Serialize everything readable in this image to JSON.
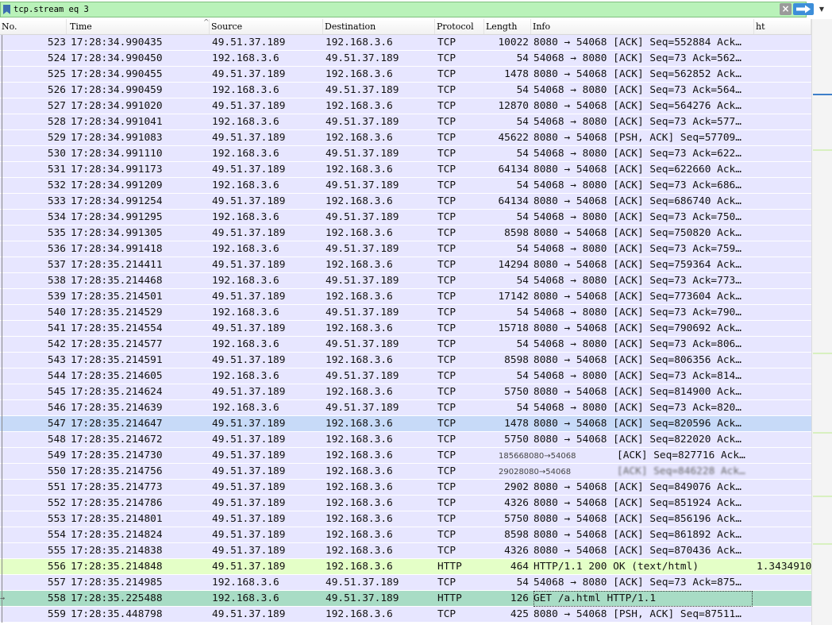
{
  "filter": {
    "value": "tcp.stream eq 3",
    "clear_icon": "close-icon",
    "apply_icon": "arrow-right-icon",
    "dropdown_icon": "chevron-down-icon"
  },
  "columns": {
    "no": "No.",
    "time": "Time",
    "source": "Source",
    "destination": "Destination",
    "protocol": "Protocol",
    "length": "Length",
    "info": "Info",
    "ht": "ht"
  },
  "colors": {
    "tcp_row": "#e7e6ff",
    "http_row": "#e4ffc7",
    "selected_row": "#c7daf8",
    "related_row": "#a8dcc5",
    "filter_bg": "#b9f2b9"
  },
  "packets": [
    {
      "no": "523",
      "time": "17:28:34.990435",
      "src": "49.51.37.189",
      "dst": "192.168.3.6",
      "proto": "TCP",
      "len": "10022",
      "info": "8080 → 54068 [ACK] Seq=552884 Ack…",
      "ht": ""
    },
    {
      "no": "524",
      "time": "17:28:34.990450",
      "src": "192.168.3.6",
      "dst": "49.51.37.189",
      "proto": "TCP",
      "len": "54",
      "info": "54068 → 8080 [ACK] Seq=73 Ack=562…",
      "ht": ""
    },
    {
      "no": "525",
      "time": "17:28:34.990455",
      "src": "49.51.37.189",
      "dst": "192.168.3.6",
      "proto": "TCP",
      "len": "1478",
      "info": "8080 → 54068 [ACK] Seq=562852 Ack…",
      "ht": ""
    },
    {
      "no": "526",
      "time": "17:28:34.990459",
      "src": "192.168.3.6",
      "dst": "49.51.37.189",
      "proto": "TCP",
      "len": "54",
      "info": "54068 → 8080 [ACK] Seq=73 Ack=564…",
      "ht": ""
    },
    {
      "no": "527",
      "time": "17:28:34.991020",
      "src": "49.51.37.189",
      "dst": "192.168.3.6",
      "proto": "TCP",
      "len": "12870",
      "info": "8080 → 54068 [ACK] Seq=564276 Ack…",
      "ht": ""
    },
    {
      "no": "528",
      "time": "17:28:34.991041",
      "src": "192.168.3.6",
      "dst": "49.51.37.189",
      "proto": "TCP",
      "len": "54",
      "info": "54068 → 8080 [ACK] Seq=73 Ack=577…",
      "ht": ""
    },
    {
      "no": "529",
      "time": "17:28:34.991083",
      "src": "49.51.37.189",
      "dst": "192.168.3.6",
      "proto": "TCP",
      "len": "45622",
      "info": "8080 → 54068 [PSH, ACK] Seq=57709…",
      "ht": ""
    },
    {
      "no": "530",
      "time": "17:28:34.991110",
      "src": "192.168.3.6",
      "dst": "49.51.37.189",
      "proto": "TCP",
      "len": "54",
      "info": "54068 → 8080 [ACK] Seq=73 Ack=622…",
      "ht": ""
    },
    {
      "no": "531",
      "time": "17:28:34.991173",
      "src": "49.51.37.189",
      "dst": "192.168.3.6",
      "proto": "TCP",
      "len": "64134",
      "info": "8080 → 54068 [ACK] Seq=622660 Ack…",
      "ht": ""
    },
    {
      "no": "532",
      "time": "17:28:34.991209",
      "src": "192.168.3.6",
      "dst": "49.51.37.189",
      "proto": "TCP",
      "len": "54",
      "info": "54068 → 8080 [ACK] Seq=73 Ack=686…",
      "ht": ""
    },
    {
      "no": "533",
      "time": "17:28:34.991254",
      "src": "49.51.37.189",
      "dst": "192.168.3.6",
      "proto": "TCP",
      "len": "64134",
      "info": "8080 → 54068 [ACK] Seq=686740 Ack…",
      "ht": ""
    },
    {
      "no": "534",
      "time": "17:28:34.991295",
      "src": "192.168.3.6",
      "dst": "49.51.37.189",
      "proto": "TCP",
      "len": "54",
      "info": "54068 → 8080 [ACK] Seq=73 Ack=750…",
      "ht": ""
    },
    {
      "no": "535",
      "time": "17:28:34.991305",
      "src": "49.51.37.189",
      "dst": "192.168.3.6",
      "proto": "TCP",
      "len": "8598",
      "info": "8080 → 54068 [ACK] Seq=750820 Ack…",
      "ht": ""
    },
    {
      "no": "536",
      "time": "17:28:34.991418",
      "src": "192.168.3.6",
      "dst": "49.51.37.189",
      "proto": "TCP",
      "len": "54",
      "info": "54068 → 8080 [ACK] Seq=73 Ack=759…",
      "ht": ""
    },
    {
      "no": "537",
      "time": "17:28:35.214411",
      "src": "49.51.37.189",
      "dst": "192.168.3.6",
      "proto": "TCP",
      "len": "14294",
      "info": "8080 → 54068 [ACK] Seq=759364 Ack…",
      "ht": ""
    },
    {
      "no": "538",
      "time": "17:28:35.214468",
      "src": "192.168.3.6",
      "dst": "49.51.37.189",
      "proto": "TCP",
      "len": "54",
      "info": "54068 → 8080 [ACK] Seq=73 Ack=773…",
      "ht": ""
    },
    {
      "no": "539",
      "time": "17:28:35.214501",
      "src": "49.51.37.189",
      "dst": "192.168.3.6",
      "proto": "TCP",
      "len": "17142",
      "info": "8080 → 54068 [ACK] Seq=773604 Ack…",
      "ht": ""
    },
    {
      "no": "540",
      "time": "17:28:35.214529",
      "src": "192.168.3.6",
      "dst": "49.51.37.189",
      "proto": "TCP",
      "len": "54",
      "info": "54068 → 8080 [ACK] Seq=73 Ack=790…",
      "ht": ""
    },
    {
      "no": "541",
      "time": "17:28:35.214554",
      "src": "49.51.37.189",
      "dst": "192.168.3.6",
      "proto": "TCP",
      "len": "15718",
      "info": "8080 → 54068 [ACK] Seq=790692 Ack…",
      "ht": ""
    },
    {
      "no": "542",
      "time": "17:28:35.214577",
      "src": "192.168.3.6",
      "dst": "49.51.37.189",
      "proto": "TCP",
      "len": "54",
      "info": "54068 → 8080 [ACK] Seq=73 Ack=806…",
      "ht": ""
    },
    {
      "no": "543",
      "time": "17:28:35.214591",
      "src": "49.51.37.189",
      "dst": "192.168.3.6",
      "proto": "TCP",
      "len": "8598",
      "info": "8080 → 54068 [ACK] Seq=806356 Ack…",
      "ht": ""
    },
    {
      "no": "544",
      "time": "17:28:35.214605",
      "src": "192.168.3.6",
      "dst": "49.51.37.189",
      "proto": "TCP",
      "len": "54",
      "info": "54068 → 8080 [ACK] Seq=73 Ack=814…",
      "ht": ""
    },
    {
      "no": "545",
      "time": "17:28:35.214624",
      "src": "49.51.37.189",
      "dst": "192.168.3.6",
      "proto": "TCP",
      "len": "5750",
      "info": "8080 → 54068 [ACK] Seq=814900 Ack…",
      "ht": ""
    },
    {
      "no": "546",
      "time": "17:28:35.214639",
      "src": "192.168.3.6",
      "dst": "49.51.37.189",
      "proto": "TCP",
      "len": "54",
      "info": "54068 → 8080 [ACK] Seq=73 Ack=820…",
      "ht": ""
    },
    {
      "no": "547",
      "time": "17:28:35.214647",
      "src": "49.51.37.189",
      "dst": "192.168.3.6",
      "proto": "TCP",
      "len": "1478",
      "info": "8080 → 54068 [ACK] Seq=820596 Ack…",
      "ht": "",
      "style": "sel-blue"
    },
    {
      "no": "548",
      "time": "17:28:35.214672",
      "src": "49.51.37.189",
      "dst": "192.168.3.6",
      "proto": "TCP",
      "len": "5750",
      "info": "8080 → 54068 [ACK] Seq=822020 Ack…",
      "ht": ""
    },
    {
      "no": "549",
      "time": "17:28:35.214730",
      "src": "49.51.37.189",
      "dst": "192.168.3.6",
      "proto": "TCP",
      "len": "",
      "info": "[ACK] Seq=827716 Ack…",
      "ht": "",
      "glitch": "185668080→54068"
    },
    {
      "no": "550",
      "time": "17:28:35.214756",
      "src": "49.51.37.189",
      "dst": "192.168.3.6",
      "proto": "TCP",
      "len": "",
      "info": "[ACK] Seq=846228 Ack…",
      "ht": "",
      "glitch": "29028080→54068",
      "blur": true
    },
    {
      "no": "551",
      "time": "17:28:35.214773",
      "src": "49.51.37.189",
      "dst": "192.168.3.6",
      "proto": "TCP",
      "len": "2902",
      "info": "8080 → 54068 [ACK] Seq=849076 Ack…",
      "ht": ""
    },
    {
      "no": "552",
      "time": "17:28:35.214786",
      "src": "49.51.37.189",
      "dst": "192.168.3.6",
      "proto": "TCP",
      "len": "4326",
      "info": "8080 → 54068 [ACK] Seq=851924 Ack…",
      "ht": ""
    },
    {
      "no": "553",
      "time": "17:28:35.214801",
      "src": "49.51.37.189",
      "dst": "192.168.3.6",
      "proto": "TCP",
      "len": "5750",
      "info": "8080 → 54068 [ACK] Seq=856196 Ack…",
      "ht": ""
    },
    {
      "no": "554",
      "time": "17:28:35.214824",
      "src": "49.51.37.189",
      "dst": "192.168.3.6",
      "proto": "TCP",
      "len": "8598",
      "info": "8080 → 54068 [ACK] Seq=861892 Ack…",
      "ht": ""
    },
    {
      "no": "555",
      "time": "17:28:35.214838",
      "src": "49.51.37.189",
      "dst": "192.168.3.6",
      "proto": "TCP",
      "len": "4326",
      "info": "8080 → 54068 [ACK] Seq=870436 Ack…",
      "ht": ""
    },
    {
      "no": "556",
      "time": "17:28:35.214848",
      "src": "49.51.37.189",
      "dst": "192.168.3.6",
      "proto": "HTTP",
      "len": "464",
      "info": "HTTP/1.1 200 OK  (text/html)",
      "ht": "1.3434910",
      "style": "http"
    },
    {
      "no": "557",
      "time": "17:28:35.214985",
      "src": "192.168.3.6",
      "dst": "49.51.37.189",
      "proto": "TCP",
      "len": "54",
      "info": "54068 → 8080 [ACK] Seq=73 Ack=875…",
      "ht": ""
    },
    {
      "no": "558",
      "time": "17:28:35.225488",
      "src": "192.168.3.6",
      "dst": "49.51.37.189",
      "proto": "HTTP",
      "len": "126",
      "info": "GET /a.html HTTP/1.1",
      "ht": "",
      "style": "sel-green",
      "arrow": "→",
      "infobox": true
    },
    {
      "no": "559",
      "time": "17:28:35.448798",
      "src": "49.51.37.189",
      "dst": "192.168.3.6",
      "proto": "TCP",
      "len": "425",
      "info": "8080 → 54068 [PSH, ACK] Seq=87511…",
      "ht": ""
    }
  ]
}
